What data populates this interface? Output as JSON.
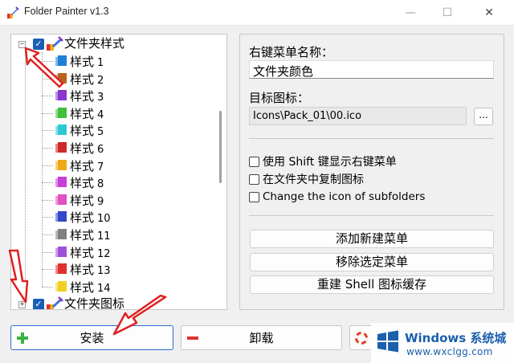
{
  "window": {
    "title": "Folder Painter v1.3",
    "minimize_glyph": "—",
    "maximize_glyph": "☐",
    "close_glyph": "✕"
  },
  "tree": {
    "root1": {
      "label": "文件夹样式",
      "expander": "−"
    },
    "children": [
      {
        "prefix": "样式",
        "num": "1",
        "color": "#1e7fd8"
      },
      {
        "prefix": "样式",
        "num": "2",
        "color": "#b8621e"
      },
      {
        "prefix": "样式",
        "num": "3",
        "color": "#8a35d0"
      },
      {
        "prefix": "样式",
        "num": "4",
        "color": "#3fbf3a"
      },
      {
        "prefix": "样式",
        "num": "5",
        "color": "#2ec8d8"
      },
      {
        "prefix": "样式",
        "num": "6",
        "color": "#d02828"
      },
      {
        "prefix": "样式",
        "num": "7",
        "color": "#f0a818"
      },
      {
        "prefix": "样式",
        "num": "8",
        "color": "#c83ed8"
      },
      {
        "prefix": "样式",
        "num": "9",
        "color": "#e050c0"
      },
      {
        "prefix": "样式",
        "num": "10",
        "color": "#3448c8"
      },
      {
        "prefix": "样式",
        "num": "11",
        "color": "#808080"
      },
      {
        "prefix": "样式",
        "num": "12",
        "color": "#a050d8"
      },
      {
        "prefix": "样式",
        "num": "13",
        "color": "#e03030"
      },
      {
        "prefix": "样式",
        "num": "14",
        "color": "#f0d020"
      }
    ],
    "root2": {
      "label": "文件夹图标",
      "expander": "+"
    }
  },
  "settings": {
    "menu_name_label": "右键菜单名称：",
    "menu_name_value": "文件夹颜色",
    "target_icon_label": "目标图标：",
    "target_icon_value": "Icons\\Pack_01\\00.ico",
    "browse_label": "...",
    "options": [
      {
        "label": "使用 Shift 键显示右键菜单",
        "checked": false
      },
      {
        "label": "在文件夹中复制图标",
        "checked": false
      },
      {
        "label": "Change the icon of subfolders",
        "checked": false
      }
    ],
    "buttons": {
      "add_menu": "添加新建菜单",
      "remove_menu": "移除选定菜单",
      "rebuild_cache": "重建 Shell 图标缓存"
    }
  },
  "bottom": {
    "install": "安装",
    "uninstall": "卸载"
  },
  "watermark": {
    "title": "Windows 系统城",
    "url": "www.wxclgg.com"
  },
  "colors": {
    "accent": "#1a5fb4",
    "annotation_arrow": "#e02020",
    "watermark_text": "#1b5fad"
  }
}
